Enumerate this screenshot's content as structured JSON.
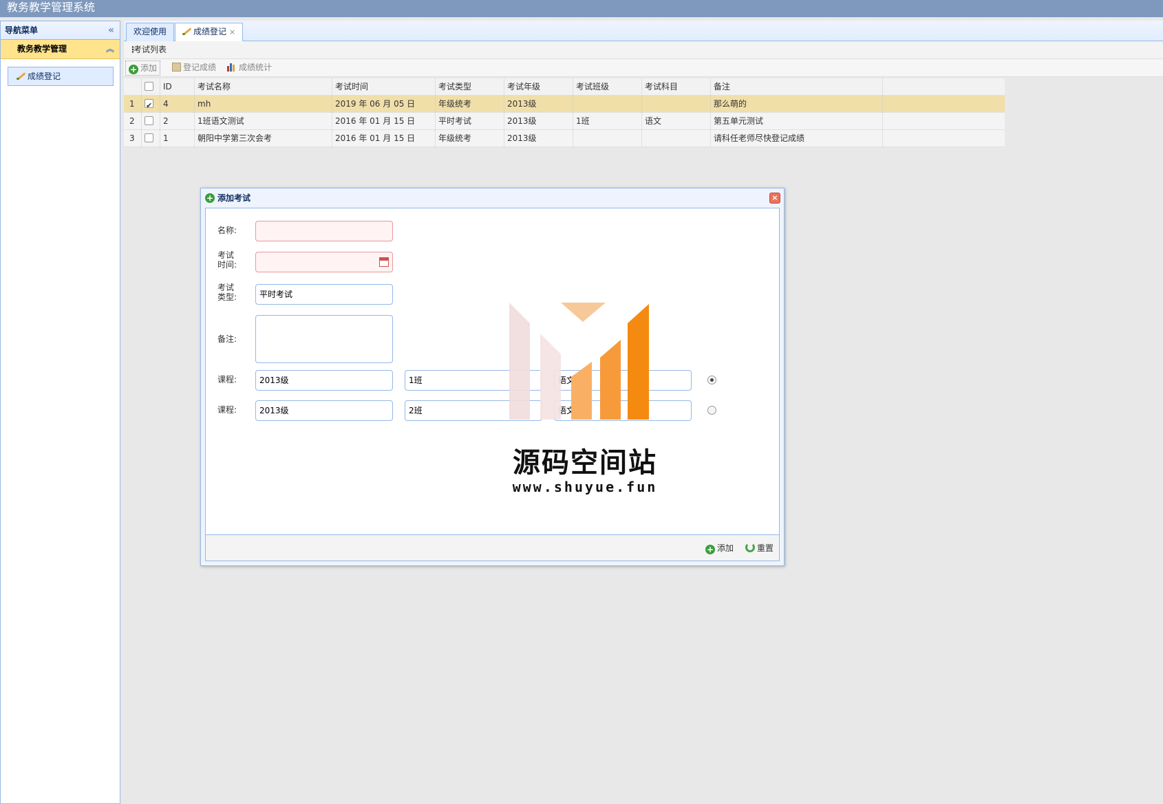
{
  "app": {
    "title": "教务教学管理系统"
  },
  "sidebar": {
    "header": "导航菜单",
    "group": "教务教学管理",
    "items": [
      {
        "label": "成绩登记"
      }
    ]
  },
  "tabs": [
    {
      "label": "欢迎使用"
    },
    {
      "label": "成绩登记",
      "close": "×"
    }
  ],
  "panel": {
    "title": "考试列表"
  },
  "toolbar": {
    "add": "添加",
    "register": "登记成绩",
    "stats": "成绩统计"
  },
  "grid": {
    "columns": [
      "ID",
      "考试名称",
      "考试时间",
      "考试类型",
      "考试年级",
      "考试班级",
      "考试科目",
      "备注"
    ],
    "rows": [
      {
        "no": "1",
        "checked": true,
        "id": "4",
        "name": "mh",
        "time": "2019 年 06 月 05 日",
        "type": "年级统考",
        "grade": "2013级",
        "clazz": "",
        "course": "",
        "remark": "那么萌的"
      },
      {
        "no": "2",
        "checked": false,
        "id": "2",
        "name": "1班语文测试",
        "time": "2016 年 01 月 15 日",
        "type": "平时考试",
        "grade": "2013级",
        "clazz": "1班",
        "course": "语文",
        "remark": "第五单元测试"
      },
      {
        "no": "3",
        "checked": false,
        "id": "1",
        "name": "朝阳中学第三次会考",
        "time": "2016 年 01 月 15 日",
        "type": "年级统考",
        "grade": "2013级",
        "clazz": "",
        "course": "",
        "remark": "请科任老师尽快登记成绩"
      }
    ]
  },
  "dialog": {
    "title": "添加考试",
    "close": "×",
    "name_label": "名称:",
    "name_value": "",
    "time_label_1": "考试",
    "time_label_2": "时间:",
    "time_value": "",
    "type_label_1": "考试",
    "type_label_2": "类型:",
    "type_value": "平时考试",
    "remark_label": "备注:",
    "remark_value": "",
    "course_rows": [
      {
        "label": "课程:",
        "grade": "2013级",
        "clazz": "1班",
        "subject": "语文",
        "selected": true
      },
      {
        "label": "课程:",
        "grade": "2013级",
        "clazz": "2班",
        "subject": "语文",
        "selected": false
      }
    ],
    "add_button": "添加",
    "reset_button": "重置"
  },
  "watermark": {
    "text": "源码空间站",
    "url": "www.shuyue.fun"
  },
  "colors": {
    "topbar": "#7f99be",
    "border": "#95b8e7",
    "selected_row": "#f0dfa9",
    "group_header": "#ffe48d"
  }
}
